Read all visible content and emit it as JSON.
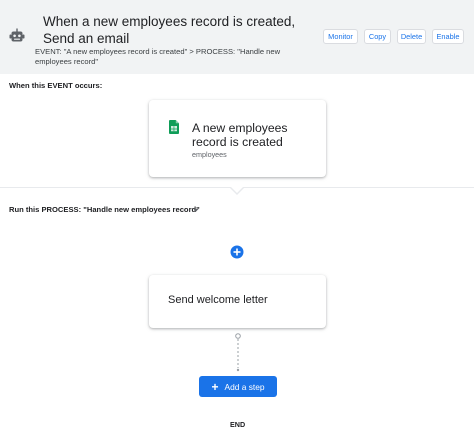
{
  "header": {
    "title": "When a new employees record is created, Send an email",
    "subtitle": "EVENT: \"A new employees record is created\" > PROCESS: \"Handle new employees record\"",
    "buttons": {
      "monitor": "Monitor",
      "copy": "Copy",
      "delete": "Delete",
      "enable": "Enable"
    },
    "icon": "robot-icon"
  },
  "event_section": {
    "label": "When this EVENT occurs:",
    "card": {
      "title": "A new employees record is created",
      "subtitle": "employees",
      "icon": "google-sheets-icon"
    }
  },
  "process_section": {
    "label": "Run this PROCESS: \"Handle new employees record\"",
    "dropdown_icon": "caret-down-icon",
    "add_icon": "add-circle-icon",
    "step": {
      "title": "Send welcome letter"
    },
    "add_step_label": "Add a step",
    "end_label": "END"
  },
  "colors": {
    "accent": "#1a73e8",
    "header_bg": "#f1f3f4",
    "sheets_green": "#0f9d58"
  }
}
